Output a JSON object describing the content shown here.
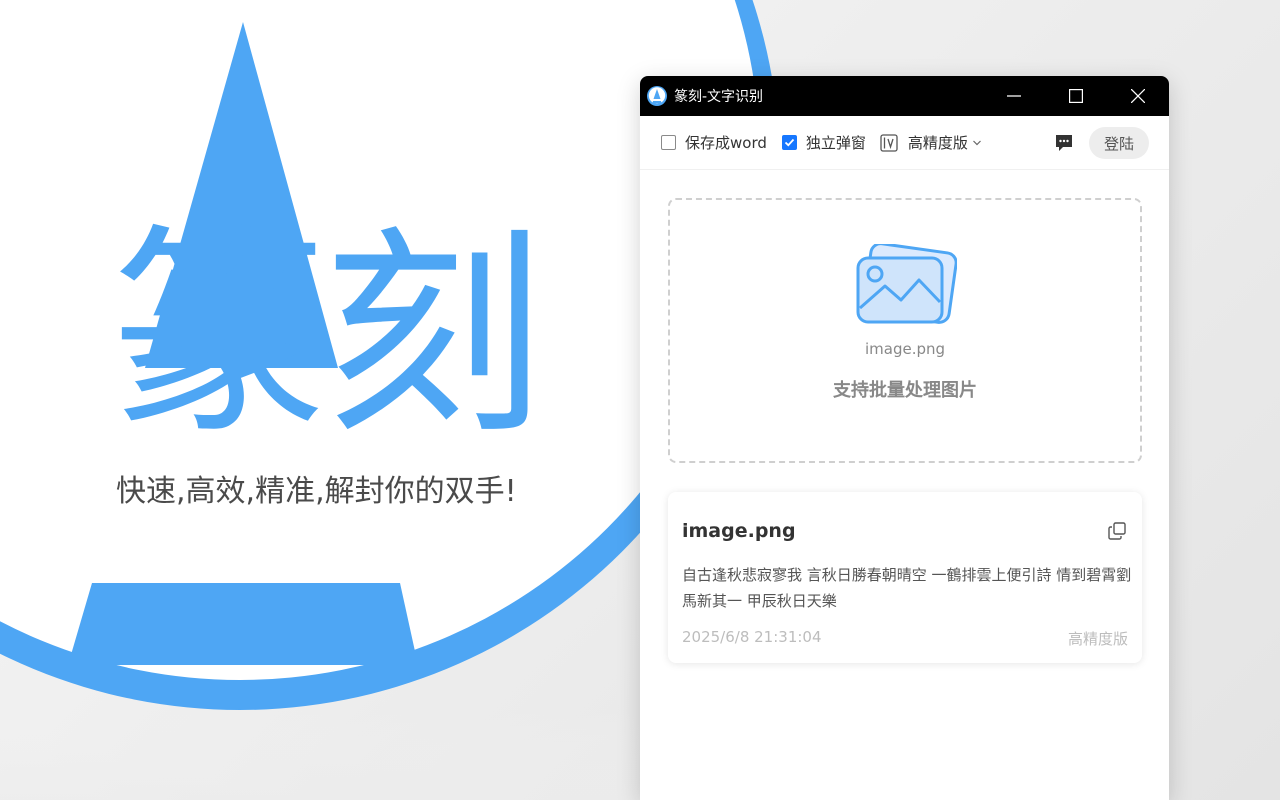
{
  "promo": {
    "brand": "篆刻",
    "slogan": "快速,高效,精准,解封你的双手!",
    "accent_color": "#4EA6F4"
  },
  "window": {
    "title": "篆刻-文字识别",
    "icons": {
      "logo": "app-logo-icon",
      "minimize": "minimize-icon",
      "maximize": "maximize-icon",
      "close": "close-icon"
    }
  },
  "toolbar": {
    "save_word": {
      "label": "保存成word",
      "checked": false
    },
    "popup": {
      "label": "独立弹窗",
      "checked": true
    },
    "mode": {
      "label": "高精度版",
      "icon": "ocr-mode-icon"
    },
    "feedback_icon": "chat-icon",
    "login_label": "登陆"
  },
  "dropzone": {
    "filename": "image.png",
    "hint": "支持批量处理图片",
    "icon": "image-icon"
  },
  "result": {
    "title": "image.png",
    "text": "自古逢秋悲寂寥我 言秋日勝春朝晴空 一鶴排雲上便引詩 情到碧霄劉馬新其一 甲辰秋日天樂",
    "time": "2025/6/8 21:31:04",
    "mode": "高精度版",
    "copy_icon": "copy-icon"
  }
}
